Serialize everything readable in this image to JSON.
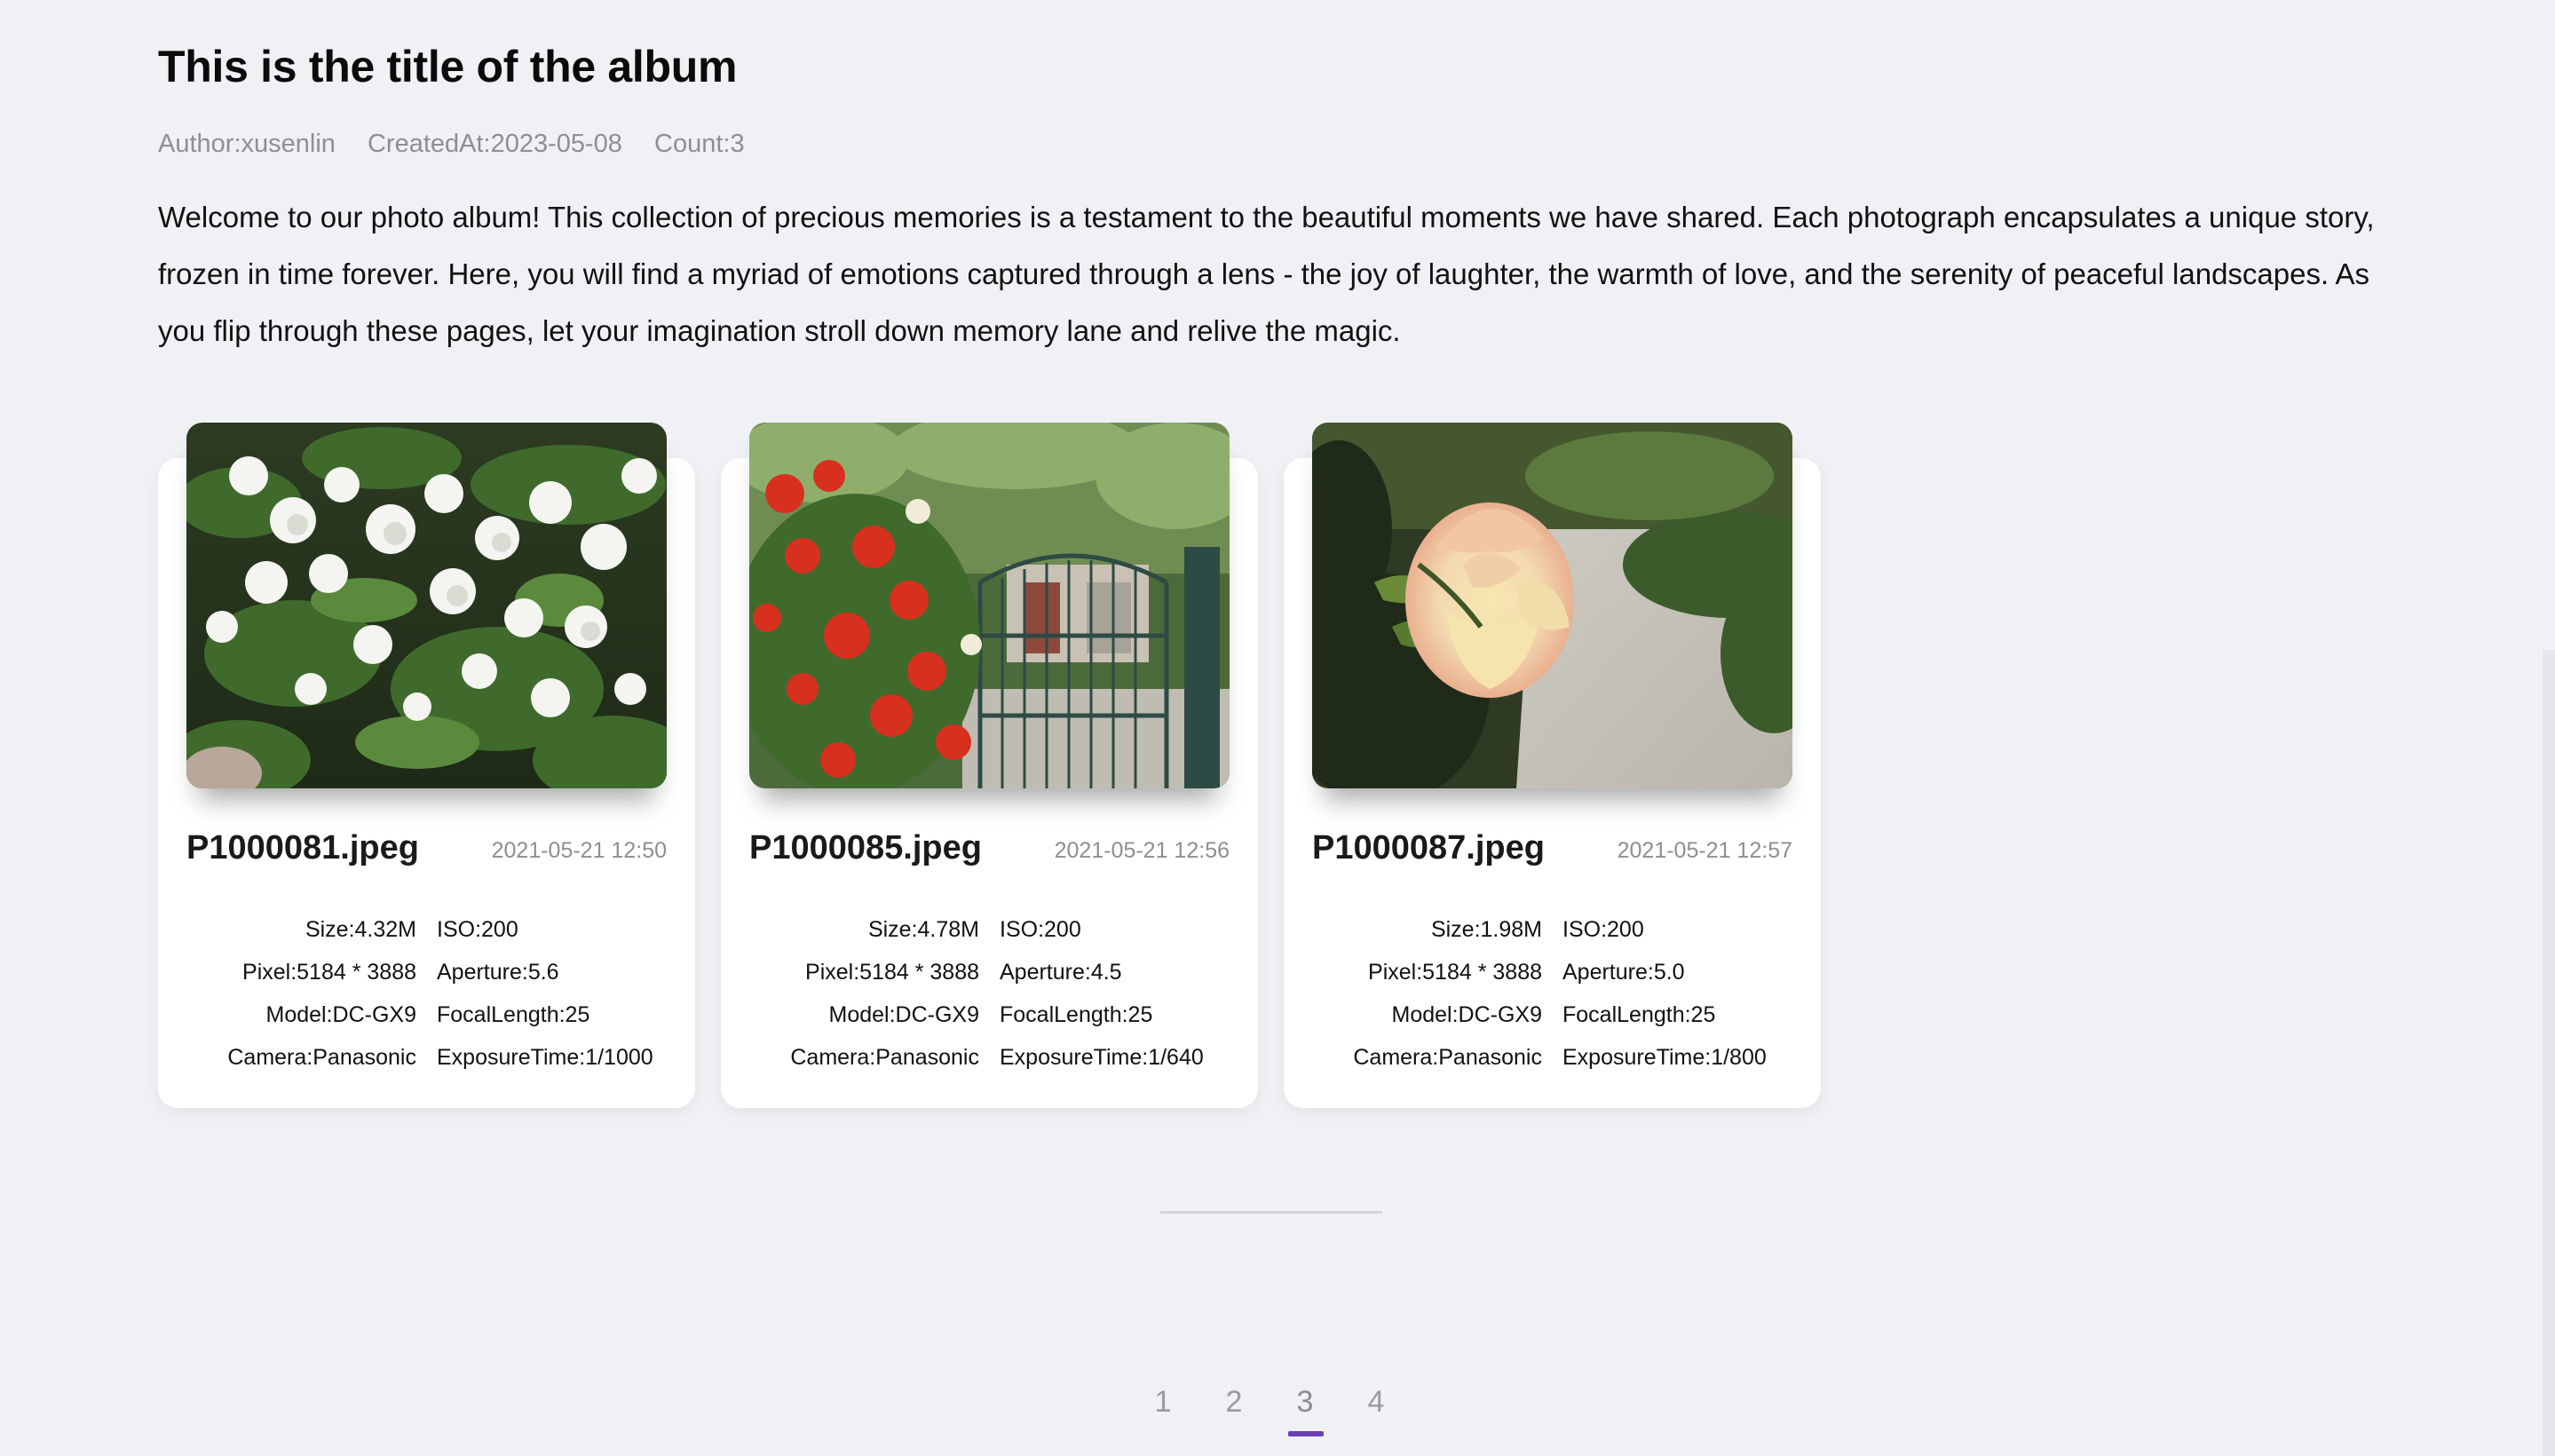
{
  "album": {
    "title": "This is the title of the album",
    "author": "Author:xusenlin",
    "created": "CreatedAt:2023-05-08",
    "count": "Count:3",
    "description": "Welcome to our photo album! This collection of precious memories is a testament to the beautiful moments we have shared. Each photograph encapsulates a unique story, frozen in time forever. Here, you will find a myriad of emotions captured through a lens - the joy of laughter, the warmth of love, and the serenity of peaceful landscapes. As you flip through these pages, let your imagination stroll down memory lane and relive the magic."
  },
  "photos": [
    {
      "name": "P1000081.jpeg",
      "date": "2021-05-21 12:50",
      "size": "Size:4.32M",
      "iso": "ISO:200",
      "pixel": "Pixel:5184 * 3888",
      "aperture": "Aperture:5.6",
      "model": "Model:DC-GX9",
      "focal": "FocalLength:25",
      "camera": "Camera:Panasonic",
      "exposure": "ExposureTime:1/1000",
      "image": "white-flower-bush"
    },
    {
      "name": "P1000085.jpeg",
      "date": "2021-05-21 12:56",
      "size": "Size:4.78M",
      "iso": "ISO:200",
      "pixel": "Pixel:5184 * 3888",
      "aperture": "Aperture:4.5",
      "model": "Model:DC-GX9",
      "focal": "FocalLength:25",
      "camera": "Camera:Panasonic",
      "exposure": "ExposureTime:1/640",
      "image": "red-roses-and-gate"
    },
    {
      "name": "P1000087.jpeg",
      "date": "2021-05-21 12:57",
      "size": "Size:1.98M",
      "iso": "ISO:200",
      "pixel": "Pixel:5184 * 3888",
      "aperture": "Aperture:5.0",
      "model": "Model:DC-GX9",
      "focal": "FocalLength:25",
      "camera": "Camera:Panasonic",
      "exposure": "ExposureTime:1/800",
      "image": "peach-rose-on-path"
    }
  ],
  "pagination": {
    "pages": [
      "1",
      "2",
      "3",
      "4"
    ],
    "active": 3,
    "accent": "#6b3fb5"
  }
}
